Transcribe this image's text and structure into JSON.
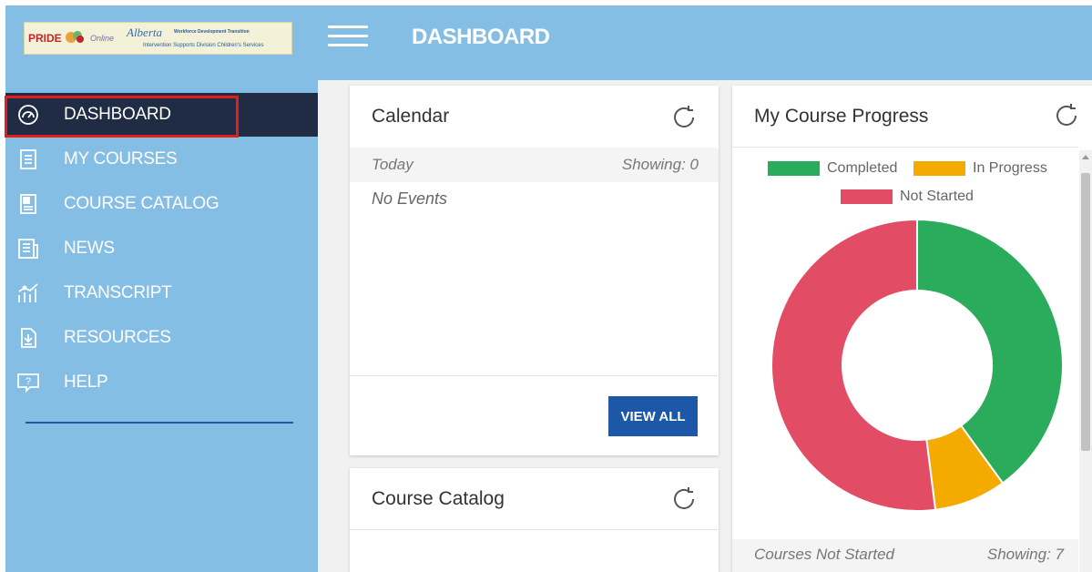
{
  "header": {
    "title": "DASHBOARD",
    "logo": {
      "pride": "PRIDE",
      "online": "Online",
      "alberta": "Alberta",
      "tagline1": "Workforce Development Transition",
      "tagline2": "Intervention Supports Division Children's Services"
    }
  },
  "sidebar": {
    "items": [
      {
        "label": "DASHBOARD",
        "icon": "speedometer-icon"
      },
      {
        "label": "MY COURSES",
        "icon": "document-list-icon"
      },
      {
        "label": "COURSE CATALOG",
        "icon": "catalog-icon"
      },
      {
        "label": "NEWS",
        "icon": "news-icon"
      },
      {
        "label": "TRANSCRIPT",
        "icon": "chart-growth-icon"
      },
      {
        "label": "RESOURCES",
        "icon": "download-file-icon"
      },
      {
        "label": "HELP",
        "icon": "help-chat-icon"
      }
    ]
  },
  "calendar": {
    "title": "Calendar",
    "today_label": "Today",
    "showing": "Showing: 0",
    "no_events": "No Events",
    "view_all": "VIEW ALL"
  },
  "course_catalog": {
    "title": "Course Catalog"
  },
  "progress": {
    "title": "My Course Progress",
    "footer_left": "Courses Not Started",
    "footer_right": "Showing: 7"
  },
  "colors": {
    "header_bg": "#85bee5",
    "active_nav_bg": "#1f2c44",
    "highlight_outline": "#e31c1c",
    "button_bg": "#1d57a8",
    "completed": "#2bac5d",
    "in_progress": "#f5aa00",
    "not_started": "#e24c64"
  },
  "chart_data": {
    "type": "pie",
    "legend": [
      "Completed",
      "In Progress",
      "Not Started"
    ],
    "values": [
      40,
      8,
      52
    ],
    "unit": "percent of courses (estimated)",
    "colors": [
      "#2bac5d",
      "#f5aa00",
      "#e24c64"
    ],
    "donut": true,
    "legend_placement": "top"
  }
}
